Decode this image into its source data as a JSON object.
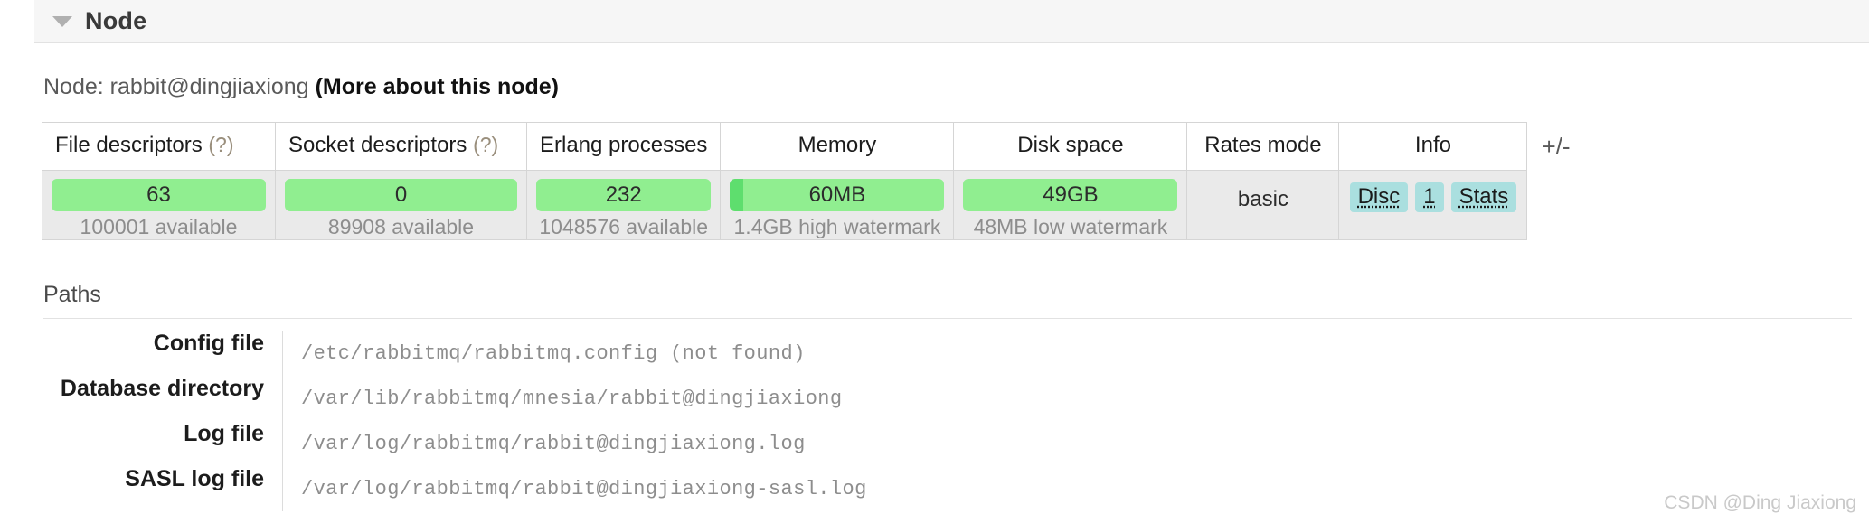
{
  "section": {
    "title": "Node",
    "collapse_icon": "caret-down-icon"
  },
  "node": {
    "prefix": "Node: rabbit@dingjiaxiong",
    "more_link": "(More about this node)"
  },
  "stats_table": {
    "toggle_label": "+/-",
    "columns": [
      {
        "label": "File descriptors",
        "help": "(?)"
      },
      {
        "label": "Socket descriptors",
        "help": "(?)"
      },
      {
        "label": "Erlang processes",
        "help": ""
      },
      {
        "label": "Memory",
        "help": ""
      },
      {
        "label": "Disk space",
        "help": ""
      },
      {
        "label": "Rates mode",
        "help": ""
      },
      {
        "label": "Info",
        "help": ""
      }
    ],
    "cells": {
      "file_descriptors": {
        "value": "63",
        "sub": "100001 available",
        "fill_pct": 0
      },
      "socket_descriptors": {
        "value": "0",
        "sub": "89908 available",
        "fill_pct": 0
      },
      "erlang_processes": {
        "value": "232",
        "sub": "1048576 available",
        "fill_pct": 0
      },
      "memory": {
        "value": "60MB",
        "sub": "1.4GB high watermark",
        "fill_pct": 6
      },
      "disk_space": {
        "value": "49GB",
        "sub": "48MB low watermark",
        "fill_pct": 0
      },
      "rates_mode": {
        "value": "basic"
      },
      "info": {
        "chips": [
          "Disc",
          "1",
          "Stats"
        ]
      }
    },
    "colors": {
      "bar_bg": "#90ee90",
      "bar_fill": "#5ede6e",
      "chip_bg": "#aadfdf",
      "row_bg": "#eaeaea"
    }
  },
  "paths": {
    "title": "Paths",
    "rows": [
      {
        "label": "Config file",
        "value": "/etc/rabbitmq/rabbitmq.config (not found)"
      },
      {
        "label": "Database directory",
        "value": "/var/lib/rabbitmq/mnesia/rabbit@dingjiaxiong"
      },
      {
        "label": "Log file",
        "value": "/var/log/rabbitmq/rabbit@dingjiaxiong.log"
      },
      {
        "label": "SASL log file",
        "value": "/var/log/rabbitmq/rabbit@dingjiaxiong-sasl.log"
      }
    ]
  },
  "watermark": "CSDN @Ding Jiaxiong"
}
